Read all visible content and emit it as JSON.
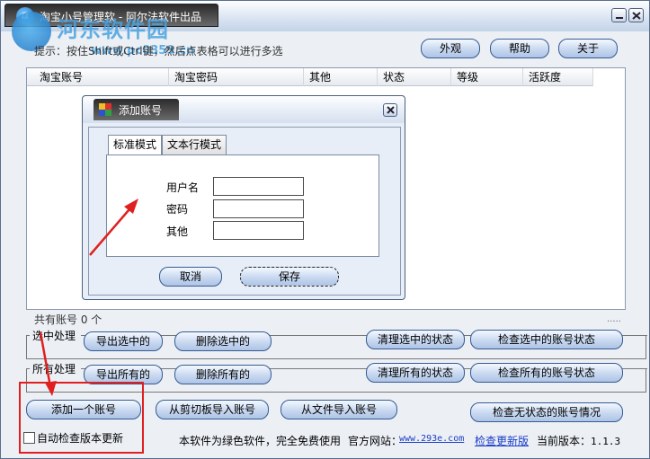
{
  "window": {
    "title": "淘宝小号管理软 - 阿尔法软件出品",
    "watermark_name": "河东软件园",
    "watermark_url": "www.pc0359.cn"
  },
  "hint": "提示：按住Shift或Ctrl键，然后点表格可以进行多选",
  "top_buttons": {
    "appearance": "外观",
    "help": "帮助",
    "about": "关于"
  },
  "list": {
    "columns": [
      "淘宝账号",
      "淘宝密码",
      "其他",
      "状态",
      "等级",
      "活跃度"
    ],
    "rows": []
  },
  "count_text": "共有账号 0 个",
  "selected_group": {
    "label": "选中处理",
    "export": "导出选中的",
    "delete": "删除选中的",
    "clear_status": "清理选中的状态",
    "check_status": "检查选中的账号状态"
  },
  "all_group": {
    "label": "所有处理",
    "export": "导出所有的",
    "delete": "删除所有的",
    "clear_status": "清理所有的状态",
    "check_status": "检查所有的账号状态"
  },
  "bottom_buttons": {
    "add": "添加一个账号",
    "clipboard_import": "从剪切板导入账号",
    "file_import": "从文件导入账号",
    "check_no_status": "检查无状态的账号情况"
  },
  "footer": {
    "auto_check_label": "自动检查版本更新",
    "auto_check_checked": false,
    "freeware": "本软件为绿色软件，完全免费使用",
    "site_label": "官方网站：",
    "site_url": "www.293e.com",
    "check_update": "检查更新版",
    "version_label": "当前版本：",
    "version_value": "1.1.3"
  },
  "dialog": {
    "title": "添加账号",
    "tabs": [
      "标准模式",
      "文本行模式"
    ],
    "active_tab": "标准模式",
    "fields": {
      "username_label": "用户名",
      "password_label": "密码",
      "other_label": "其他",
      "username_value": "",
      "password_value": "",
      "other_value": ""
    },
    "cancel": "取消",
    "save": "保存"
  },
  "colors": {
    "annotation_red": "#e02020",
    "link_blue": "#1a3cc8",
    "button_border": "#355a92"
  }
}
